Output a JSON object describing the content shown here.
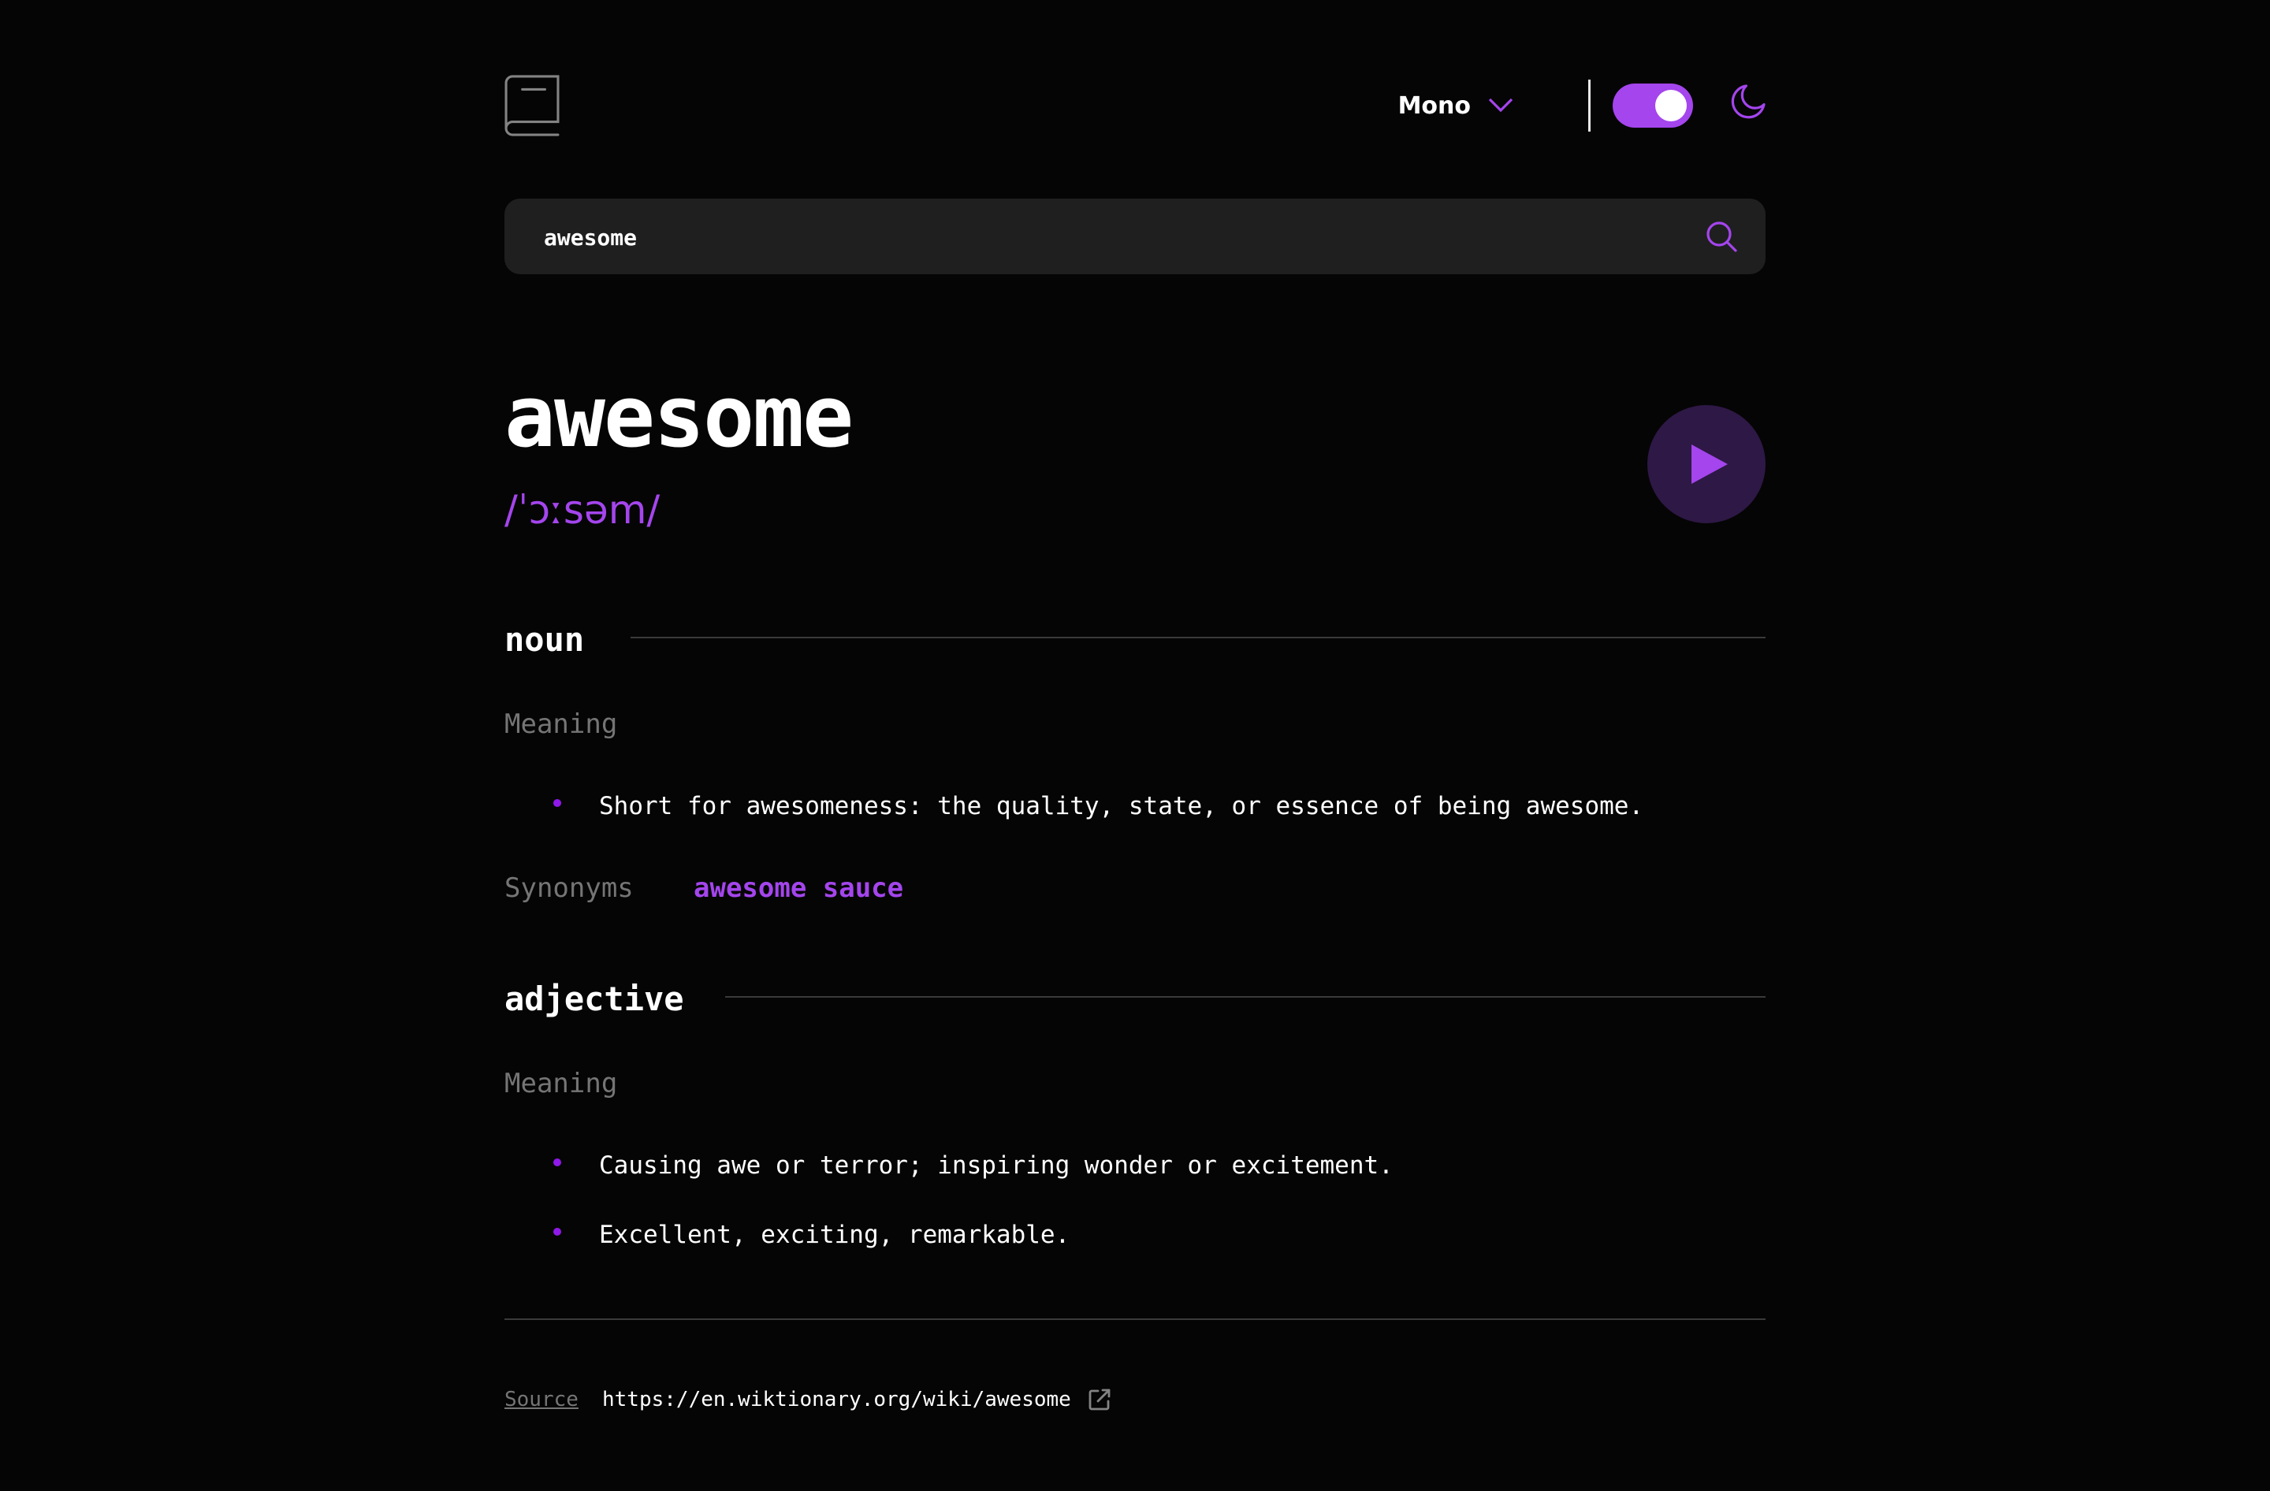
{
  "header": {
    "logo_icon": "book-icon",
    "font": {
      "selected": "Mono"
    },
    "theme": {
      "dark_mode": true,
      "icon": "moon-icon"
    }
  },
  "search": {
    "value": "awesome",
    "icon": "search-icon"
  },
  "entry": {
    "word": "awesome",
    "phonetic": "/ˈɔːsəm/",
    "play_icon": "play-icon",
    "meanings": [
      {
        "part_of_speech": "noun",
        "heading": "Meaning",
        "definitions": [
          "Short for awesomeness: the quality, state, or essence of being awesome."
        ],
        "synonyms_label": "Synonyms",
        "synonyms": [
          "awesome sauce"
        ]
      },
      {
        "part_of_speech": "adjective",
        "heading": "Meaning",
        "definitions": [
          "Causing awe or terror; inspiring wonder or excitement.",
          "Excellent, exciting, remarkable."
        ]
      }
    ]
  },
  "source": {
    "label": "Source",
    "url": "https://en.wiktionary.org/wiki/awesome",
    "icon": "external-link-icon"
  },
  "colors": {
    "background": "#050505",
    "accent": "#a445ed",
    "muted": "#757575",
    "input_bg": "#1f1f1f"
  }
}
